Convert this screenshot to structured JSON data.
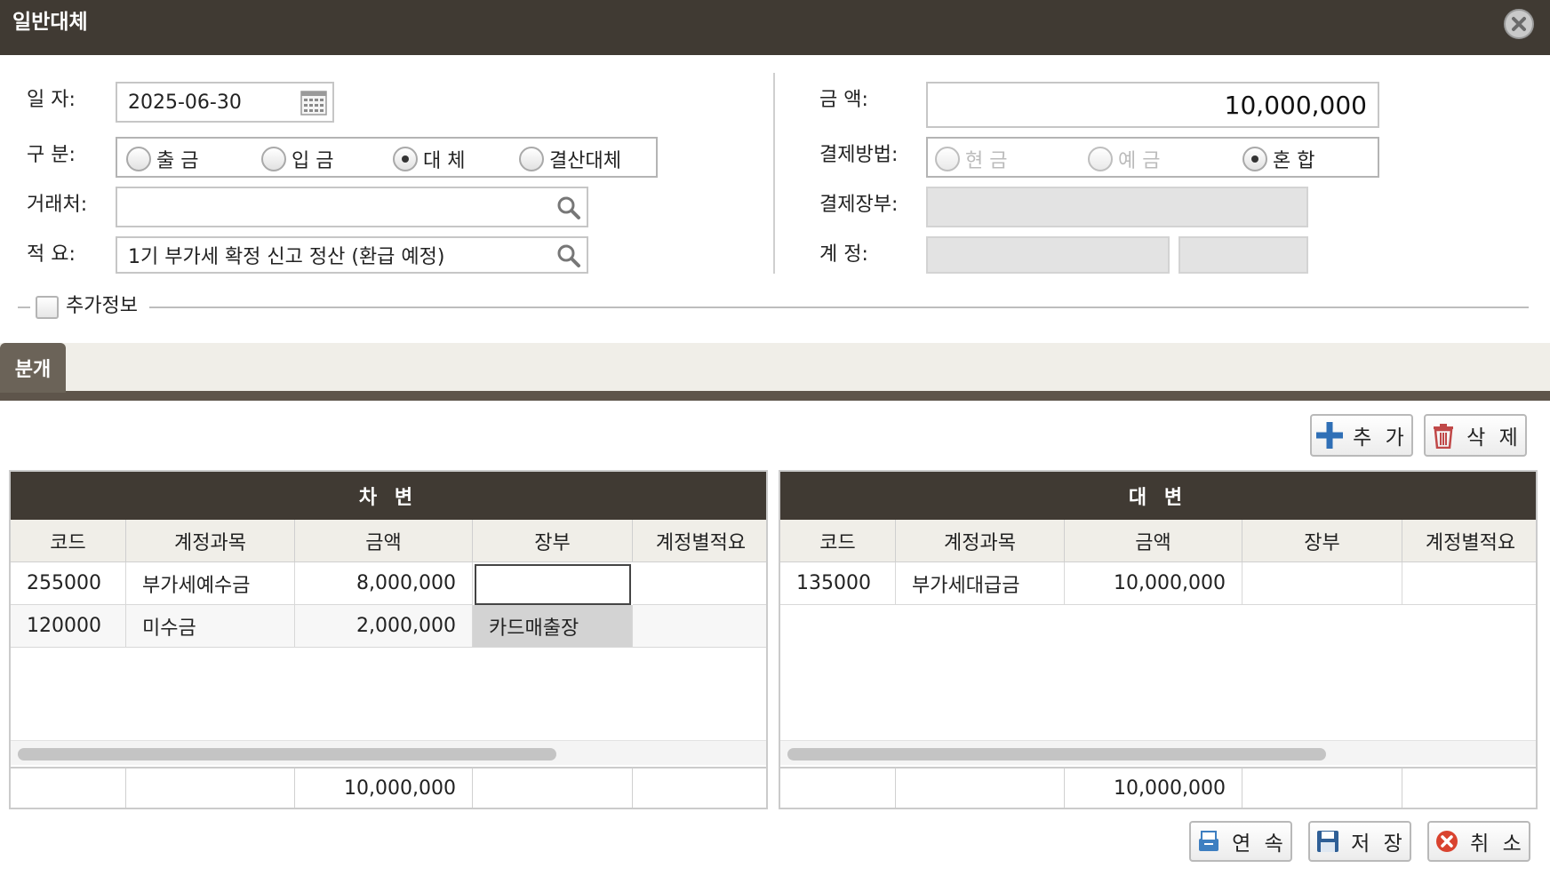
{
  "window": {
    "title": "일반대체"
  },
  "form": {
    "date_label": "일    자:",
    "date_value": "2025-06-30",
    "type_label": "구    분:",
    "type_options": [
      {
        "label": "출 금",
        "selected": false
      },
      {
        "label": "입 금",
        "selected": false
      },
      {
        "label": "대 체",
        "selected": true
      },
      {
        "label": "결산대체",
        "selected": false
      }
    ],
    "partner_label": "거래처:",
    "partner_value": "",
    "memo_label": "적    요:",
    "memo_value": "1기 부가세 확정 신고 정산 (환급 예정)",
    "amount_label": "금        액:",
    "amount_value": "10,000,000",
    "payment_label": "결제방법:",
    "payment_options": [
      {
        "label": "현 금",
        "selected": false,
        "disabled": true
      },
      {
        "label": "예 금",
        "selected": false,
        "disabled": true
      },
      {
        "label": "혼 합",
        "selected": true,
        "disabled": false
      }
    ],
    "ledger_label": "결제장부:",
    "account_label": "계    정:",
    "extra_info_label": "추가정보"
  },
  "tabs": [
    {
      "label": "분개",
      "active": true
    }
  ],
  "toolbar": {
    "add_label": "추 가",
    "delete_label": "삭 제"
  },
  "debit": {
    "title": "차 변",
    "columns": [
      "코드",
      "계정과목",
      "금액",
      "장부",
      "계정별적요"
    ],
    "rows": [
      {
        "code": "255000",
        "account": "부가세예수금",
        "amount": "8,000,000",
        "ledger": "",
        "memo": ""
      },
      {
        "code": "120000",
        "account": "미수금",
        "amount": "2,000,000",
        "ledger": "카드매출장",
        "memo": ""
      }
    ],
    "total": "10,000,000"
  },
  "credit": {
    "title": "대 변",
    "columns": [
      "코드",
      "계정과목",
      "금액",
      "장부",
      "계정별적요"
    ],
    "rows": [
      {
        "code": "135000",
        "account": "부가세대급금",
        "amount": "10,000,000",
        "ledger": "",
        "memo": ""
      }
    ],
    "total": "10,000,000"
  },
  "footer": {
    "continue_label": "연 속",
    "save_label": "저 장",
    "cancel_label": "취 소"
  }
}
